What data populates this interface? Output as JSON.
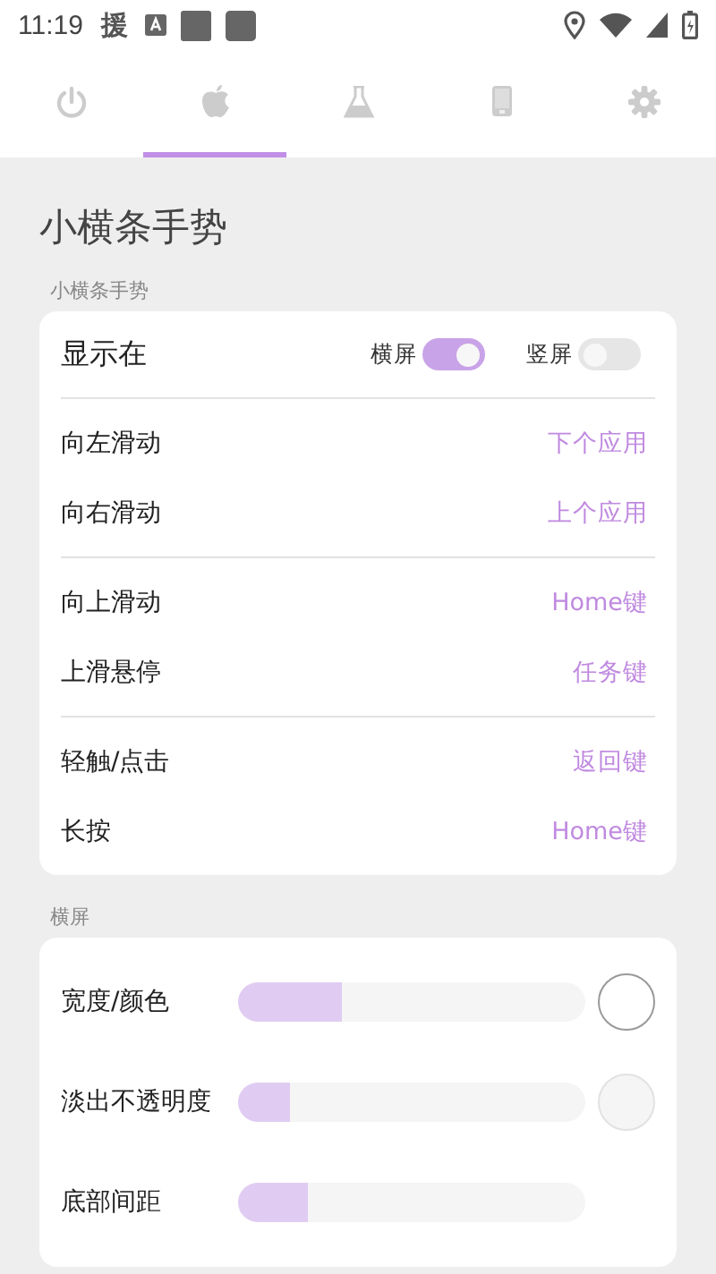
{
  "status_bar": {
    "time": "11:19",
    "notification": "援"
  },
  "tabs": [
    {
      "selected": false
    },
    {
      "selected": true
    },
    {
      "selected": false
    },
    {
      "selected": false
    },
    {
      "selected": false
    }
  ],
  "page_title": "小横条手势",
  "gesture_section": {
    "label": "小横条手势",
    "show_on": {
      "label": "显示在",
      "toggles": [
        {
          "label": "横屏",
          "on": true
        },
        {
          "label": "竖屏",
          "on": false
        }
      ]
    },
    "groups": [
      [
        {
          "label": "向左滑动",
          "value": "下个应用"
        },
        {
          "label": "向右滑动",
          "value": "上个应用"
        }
      ],
      [
        {
          "label": "向上滑动",
          "value": "Home键"
        },
        {
          "label": "上滑悬停",
          "value": "任务键"
        }
      ],
      [
        {
          "label": "轻触/点击",
          "value": "返回键"
        },
        {
          "label": "长按",
          "value": "Home键"
        }
      ]
    ]
  },
  "landscape_section": {
    "label": "横屏",
    "sliders": [
      {
        "label": "宽度/颜色",
        "level": 0.3,
        "color": "#ffffff"
      },
      {
        "label": "淡出不透明度",
        "level": 0.15,
        "color": "#f5f5f5"
      },
      {
        "label": "底部间距",
        "level": 0.2
      }
    ]
  }
}
